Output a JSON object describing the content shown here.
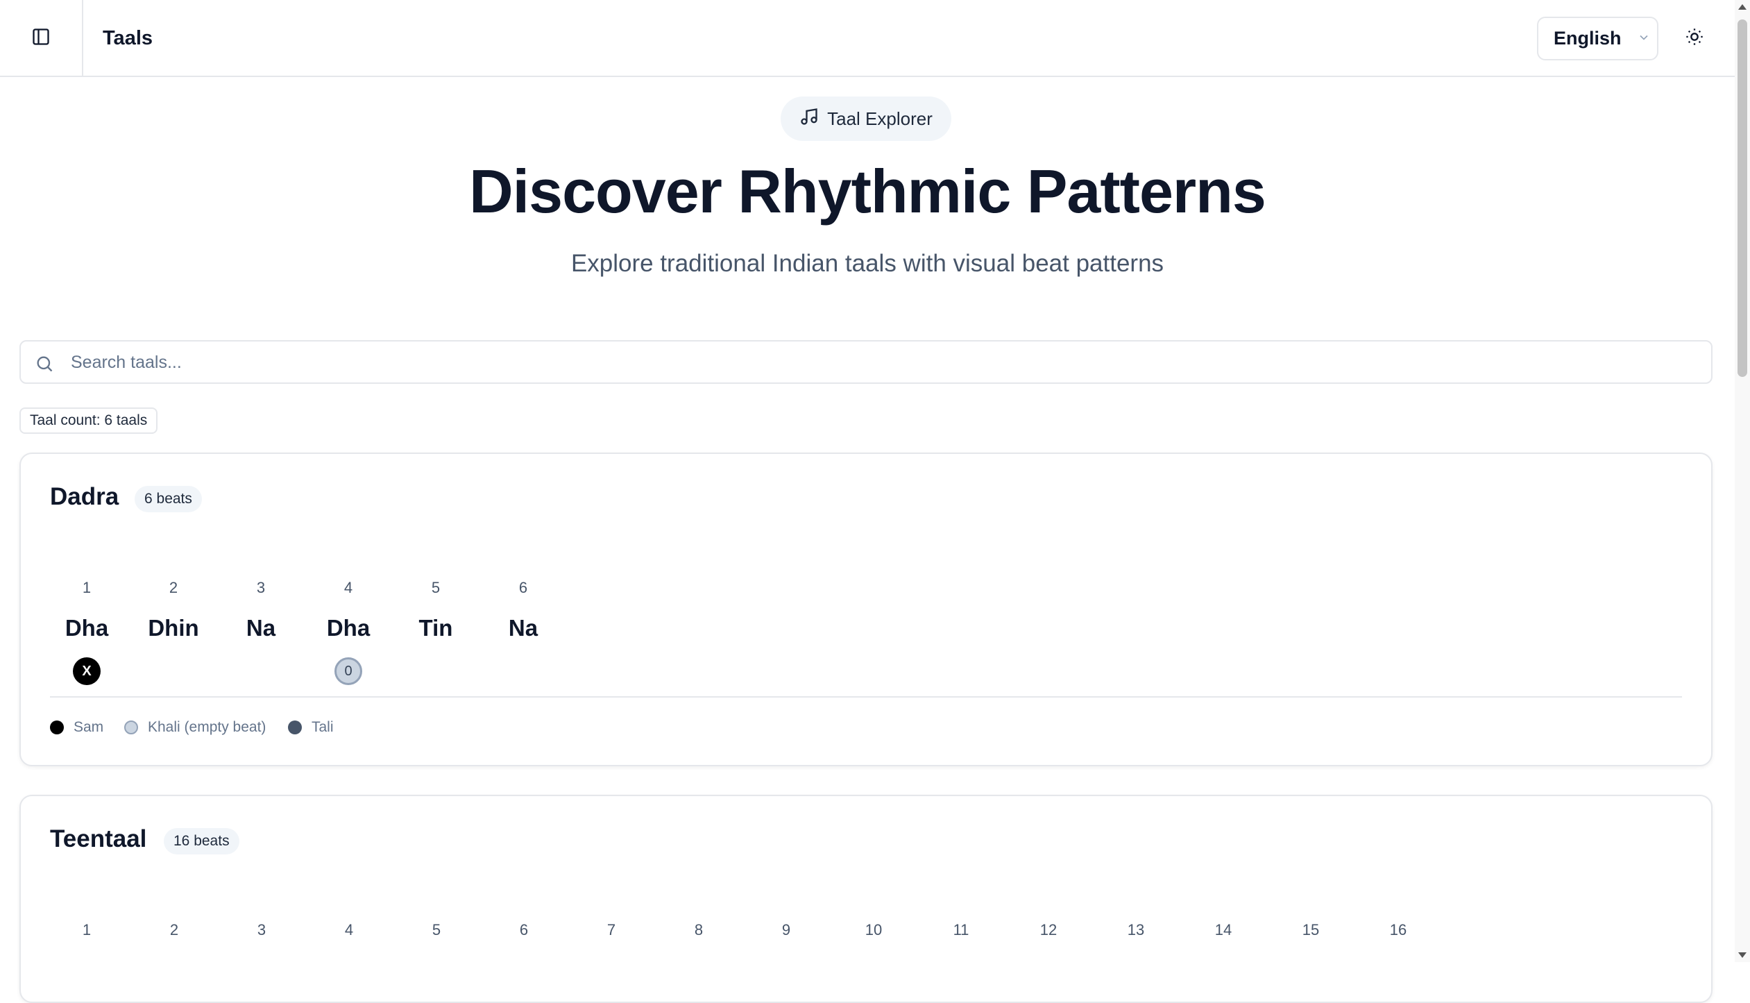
{
  "header": {
    "title": "Taals",
    "language": "English",
    "icons": {
      "sidebar": "sidebar-toggle-icon",
      "theme": "sun-icon",
      "chevron": "chevron-down-icon"
    }
  },
  "hero": {
    "badge": "Taal Explorer",
    "title": "Discover Rhythmic Patterns",
    "subtitle": "Explore traditional Indian taals with visual beat patterns"
  },
  "search": {
    "placeholder": "Search taals...",
    "value": ""
  },
  "taal_count": "Taal count: 6 taals",
  "legend": {
    "sam": "Sam",
    "khali": "Khali (empty beat)",
    "tali": "Tali"
  },
  "colors": {
    "sam": "#000000",
    "khali": "#cbd5e1",
    "tali": "#475569"
  },
  "taals": [
    {
      "name": "Dadra",
      "beats_label": "6 beats",
      "beats": [
        {
          "num": "1",
          "bol": "Dha",
          "marker": "X",
          "type": "sam"
        },
        {
          "num": "2",
          "bol": "Dhin",
          "marker": "",
          "type": ""
        },
        {
          "num": "3",
          "bol": "Na",
          "marker": "",
          "type": ""
        },
        {
          "num": "4",
          "bol": "Dha",
          "marker": "0",
          "type": "khali"
        },
        {
          "num": "5",
          "bol": "Tin",
          "marker": "",
          "type": ""
        },
        {
          "num": "6",
          "bol": "Na",
          "marker": "",
          "type": ""
        }
      ]
    },
    {
      "name": "Teentaal",
      "beats_label": "16 beats",
      "beat_numbers": [
        "1",
        "2",
        "3",
        "4",
        "5",
        "6",
        "7",
        "8",
        "9",
        "10",
        "11",
        "12",
        "13",
        "14",
        "15",
        "16"
      ]
    }
  ]
}
